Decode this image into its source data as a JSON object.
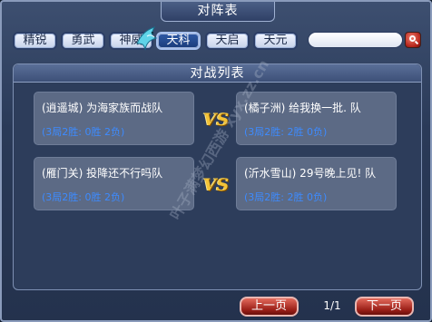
{
  "window": {
    "title": "对阵表"
  },
  "tabs": [
    {
      "label": "精锐",
      "active": false
    },
    {
      "label": "勇武",
      "active": false
    },
    {
      "label": "神威",
      "active": false
    },
    {
      "label": "天科",
      "active": true
    },
    {
      "label": "天启",
      "active": false
    },
    {
      "label": "天元",
      "active": false
    }
  ],
  "search": {
    "value": "",
    "placeholder": ""
  },
  "panel": {
    "title": "对战列表"
  },
  "matches": [
    {
      "left": {
        "name": "(逍遥城) 为海家族而战队",
        "record": "(3局2胜: 0胜 2负)"
      },
      "vs": "VS",
      "right": {
        "name": "(橘子洲) 给我换一批. 队",
        "record": "(3局2胜: 2胜 0负)"
      }
    },
    {
      "left": {
        "name": "(雁门关) 投降还不行吗队",
        "record": "(3局2胜: 0胜 2负)"
      },
      "vs": "VS",
      "right": {
        "name": "(沂水雪山) 29号晚上见! 队",
        "record": "(3局2胜: 2胜 0负)"
      }
    }
  ],
  "watermark": "叶子满梦幻西游 xyx.zz.cn",
  "pagination": {
    "prev_label": "上一页",
    "page_info": "1/1",
    "next_label": "下一页"
  },
  "colors": {
    "accent": "#f3c338",
    "record_text": "#3d8bff",
    "page_button": "#b3231a"
  },
  "icons": {
    "search_button": "magnifier-icon",
    "tab_decoration": "bird-icon"
  }
}
